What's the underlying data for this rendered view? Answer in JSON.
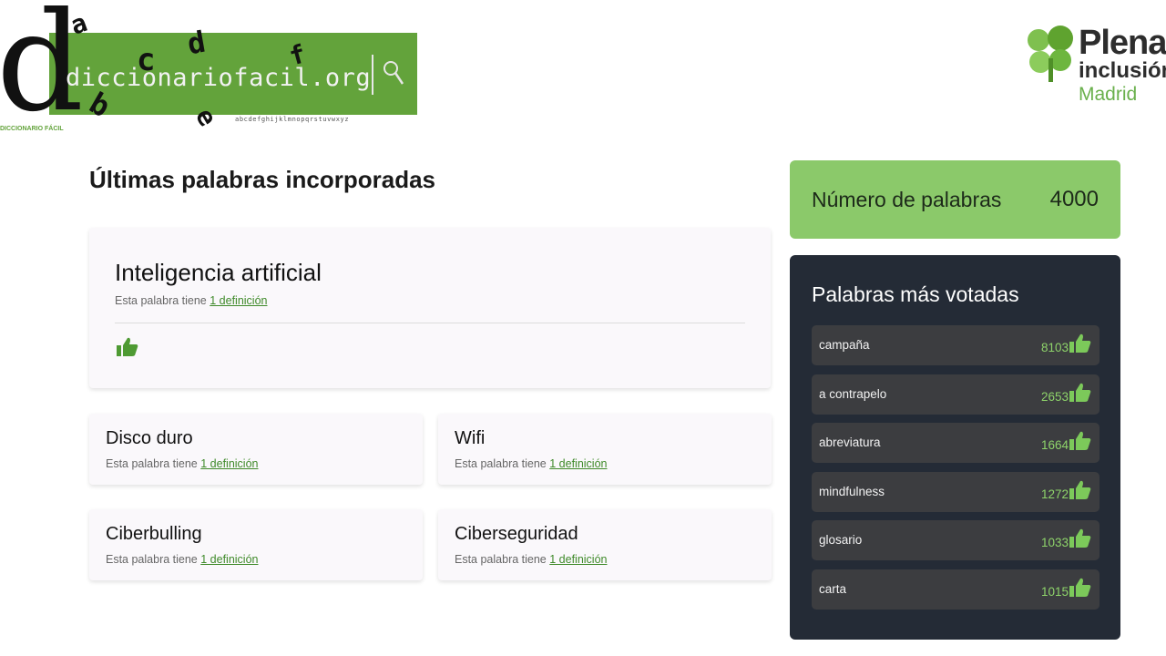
{
  "logo": {
    "site_name": "diccionariofacil.org",
    "alphabet": "abcdefghijklmnopqrstuvwxyz",
    "caption": "DICCIONARIO FÁCIL",
    "big_letter": "d",
    "letters": [
      "a",
      "b",
      "c",
      "d",
      "e",
      "f"
    ],
    "brand_green": "#63a33b"
  },
  "partner": {
    "line1": "Plena",
    "line2": "inclusión",
    "line3": "Madrid"
  },
  "main": {
    "section_title": "Últimas palabras incorporadas",
    "meta_prefix": "Esta palabra tiene",
    "featured": {
      "word": "Inteligencia artificial",
      "definitions": "1 definición"
    },
    "cards": [
      {
        "word": "Disco duro",
        "definitions": "1 definición"
      },
      {
        "word": "Wifi",
        "definitions": "1 definición"
      },
      {
        "word": "Ciberbulling",
        "definitions": "1 definición"
      },
      {
        "word": "Ciberseguridad",
        "definitions": "1 definición"
      }
    ]
  },
  "sidebar": {
    "count_label": "Número de palabras",
    "count_value": "4000",
    "top_title": "Palabras más votadas",
    "top_words": [
      {
        "word": "campaña",
        "votes": "8103"
      },
      {
        "word": "a contrapelo",
        "votes": "2653"
      },
      {
        "word": "abreviatura",
        "votes": "1664"
      },
      {
        "word": "mindfulness",
        "votes": "1272"
      },
      {
        "word": "glosario",
        "votes": "1033"
      },
      {
        "word": "carta",
        "votes": "1015"
      }
    ],
    "accent_green": "#8bc96a",
    "panel_color": "#242b36"
  }
}
